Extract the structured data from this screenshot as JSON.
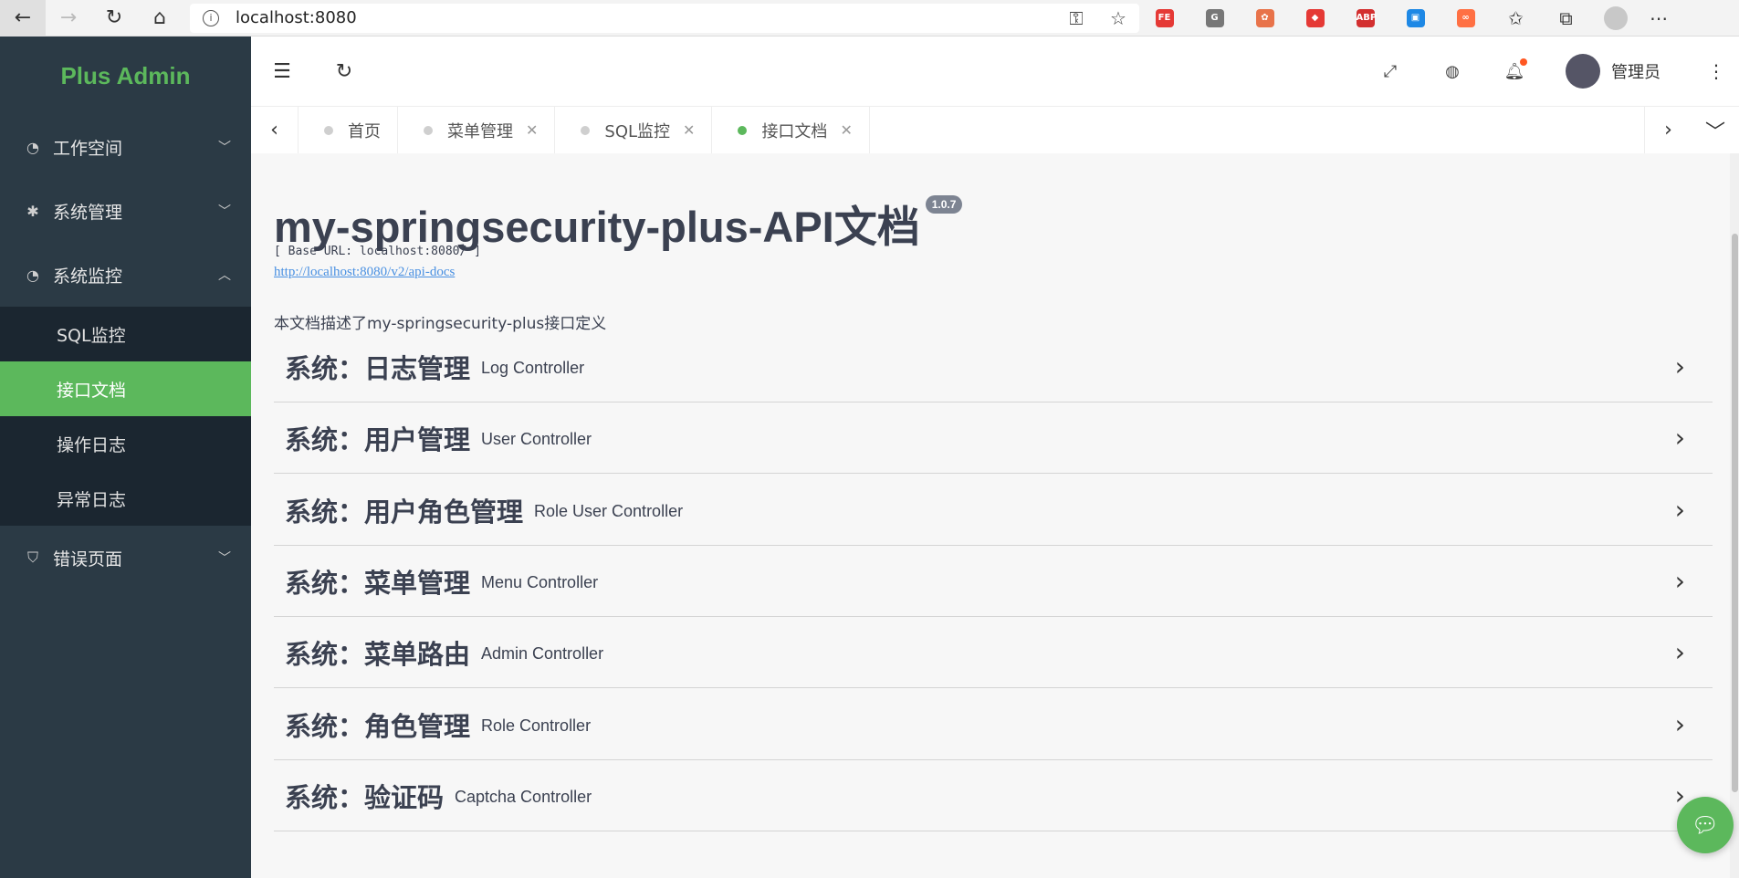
{
  "browser": {
    "address": "localhost:8080",
    "extensions": [
      {
        "name": "fe-extension-icon",
        "label": "FE",
        "color": "#e53935"
      },
      {
        "name": "grammarly-icon",
        "label": "G",
        "color": "#777777"
      },
      {
        "name": "ext-tree-icon",
        "label": "✿",
        "color": "#e8734a"
      },
      {
        "name": "ext-box-icon",
        "label": "◆",
        "color": "#e53935"
      },
      {
        "name": "adblock-icon",
        "label": "ABP",
        "color": "#d32f2f"
      },
      {
        "name": "ext-blue-icon",
        "label": "▣",
        "color": "#1e88e5"
      },
      {
        "name": "ext-infinity-icon",
        "label": "∞",
        "color": "#ff7043"
      }
    ]
  },
  "sidebar": {
    "brand": "Plus Admin",
    "groups": [
      {
        "label": "工作空间",
        "icon": "dashboard-icon",
        "expanded": false
      },
      {
        "label": "系统管理",
        "icon": "gear-icon",
        "expanded": false
      },
      {
        "label": "系统监控",
        "icon": "dashboard-icon",
        "expanded": true
      },
      {
        "label": "错误页面",
        "icon": "shield-icon",
        "expanded": false
      }
    ],
    "submenu": [
      {
        "label": "SQL监控"
      },
      {
        "label": "接口文档",
        "active": true
      },
      {
        "label": "操作日志"
      },
      {
        "label": "异常日志"
      }
    ]
  },
  "header": {
    "user_name": "管理员"
  },
  "tabs": [
    {
      "label": "首页",
      "closable": false
    },
    {
      "label": "菜单管理",
      "closable": true
    },
    {
      "label": "SQL监控",
      "closable": true
    },
    {
      "label": "接口文档",
      "closable": true,
      "active": true
    }
  ],
  "doc": {
    "title": "my-springsecurity-plus-API文档",
    "version": "1.0.7",
    "base_url": "[ Base URL: localhost:8080/ ]",
    "api_link": "http://localhost:8080/v2/api-docs",
    "description": "本文档描述了my-springsecurity-plus接口定义",
    "controllers": [
      {
        "name": "系统：日志管理",
        "desc": "Log Controller"
      },
      {
        "name": "系统：用户管理",
        "desc": "User Controller"
      },
      {
        "name": "系统：用户角色管理",
        "desc": "Role User Controller"
      },
      {
        "name": "系统：菜单管理",
        "desc": "Menu Controller"
      },
      {
        "name": "系统：菜单路由",
        "desc": "Admin Controller"
      },
      {
        "name": "系统：角色管理",
        "desc": "Role Controller"
      },
      {
        "name": "系统：验证码",
        "desc": "Captcha Controller"
      }
    ]
  },
  "colors": {
    "accent": "#5cb85c",
    "sidebar_bg": "#2b3a45",
    "submenu_bg": "#1b2630"
  }
}
